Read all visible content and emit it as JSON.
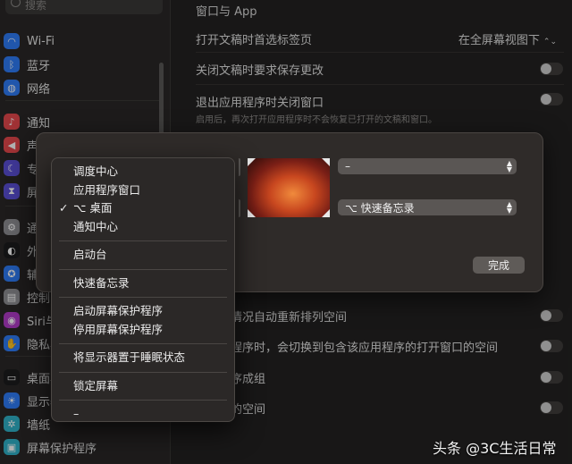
{
  "sidebar": {
    "search_placeholder": "搜索",
    "items": [
      {
        "label": "Wi-Fi",
        "icon": "wifi-icon",
        "color": "#2f7cf6",
        "glyph": "◠"
      },
      {
        "label": "蓝牙",
        "icon": "bluetooth-icon",
        "color": "#2f7cf6",
        "glyph": "ᛒ"
      },
      {
        "label": "网络",
        "icon": "globe-icon",
        "color": "#2f7cf6",
        "glyph": "◍"
      },
      {
        "label": "通知",
        "icon": "bell-icon",
        "color": "#e5484d",
        "glyph": "♪"
      },
      {
        "label": "声",
        "icon": "speaker-icon",
        "color": "#e5484d",
        "glyph": "◀"
      },
      {
        "label": "专",
        "icon": "moon-icon",
        "color": "#5b4fd6",
        "glyph": "☾"
      },
      {
        "label": "屏",
        "icon": "hourglass-icon",
        "color": "#5b4fd6",
        "glyph": "⧗"
      },
      {
        "label": "通",
        "icon": "gear-icon",
        "color": "#8e8e93",
        "glyph": "⚙"
      },
      {
        "label": "外",
        "icon": "appearance-icon",
        "color": "#1c1c1e",
        "glyph": "◐"
      },
      {
        "label": "辅",
        "icon": "accessibility-icon",
        "color": "#2f7cf6",
        "glyph": "✪"
      },
      {
        "label": "控制中",
        "icon": "control-center-icon",
        "color": "#8e8e93",
        "glyph": "▤"
      },
      {
        "label": "Siri与",
        "icon": "siri-icon",
        "color": "#b03cc8",
        "glyph": "◉"
      },
      {
        "label": "隐私与",
        "icon": "hand-icon",
        "color": "#2f7cf6",
        "glyph": "✋"
      },
      {
        "label": "桌面与",
        "icon": "desktop-dock-icon",
        "color": "#1c1c1e",
        "glyph": "▭"
      },
      {
        "label": "显示器",
        "icon": "display-icon",
        "color": "#2f7cf6",
        "glyph": "☀"
      },
      {
        "label": "墙纸",
        "icon": "wallpaper-icon",
        "color": "#30b0c7",
        "glyph": "✲"
      },
      {
        "label": "屏幕保护程序",
        "icon": "screensaver-icon",
        "color": "#30b0c7",
        "glyph": "▣"
      }
    ]
  },
  "main": {
    "section_title": "窗口与 App",
    "rows": [
      {
        "label": "打开文稿时首选标签页",
        "value": "在全屏幕视图下"
      },
      {
        "label": "关闭文稿时要求保存更改"
      },
      {
        "label": "退出应用程序时关闭窗口",
        "sub": "启用后，再次打开应用程序时不会恢复已打开的文稿和窗口。"
      }
    ],
    "lower_rows": [
      {
        "label": "的使用情况自动重新排列空间"
      },
      {
        "label": "个应用程序时，会切换到包含该应用程序的打开窗口的空间"
      },
      {
        "label": "应用程序成组"
      },
      {
        "label": "有单独的空间"
      }
    ]
  },
  "sheet": {
    "popup_top": "–",
    "popup_bottom": "⌥ 快速备忘录",
    "done_label": "完成"
  },
  "menu": {
    "groups": [
      [
        {
          "label": "调度中心",
          "checked": false
        },
        {
          "label": "应用程序窗口",
          "checked": false
        },
        {
          "label": "⌥ 桌面",
          "checked": true
        },
        {
          "label": "通知中心",
          "checked": false
        }
      ],
      [
        {
          "label": "启动台",
          "checked": false
        }
      ],
      [
        {
          "label": "快速备忘录",
          "checked": false
        }
      ],
      [
        {
          "label": "启动屏幕保护程序",
          "checked": false
        },
        {
          "label": "停用屏幕保护程序",
          "checked": false
        }
      ],
      [
        {
          "label": "将显示器置于睡眠状态",
          "checked": false
        }
      ],
      [
        {
          "label": "锁定屏幕",
          "checked": false
        }
      ],
      [
        {
          "label": "–",
          "checked": false
        }
      ]
    ],
    "check_glyph": "✓"
  },
  "watermark": "头条 @3C生活日常"
}
